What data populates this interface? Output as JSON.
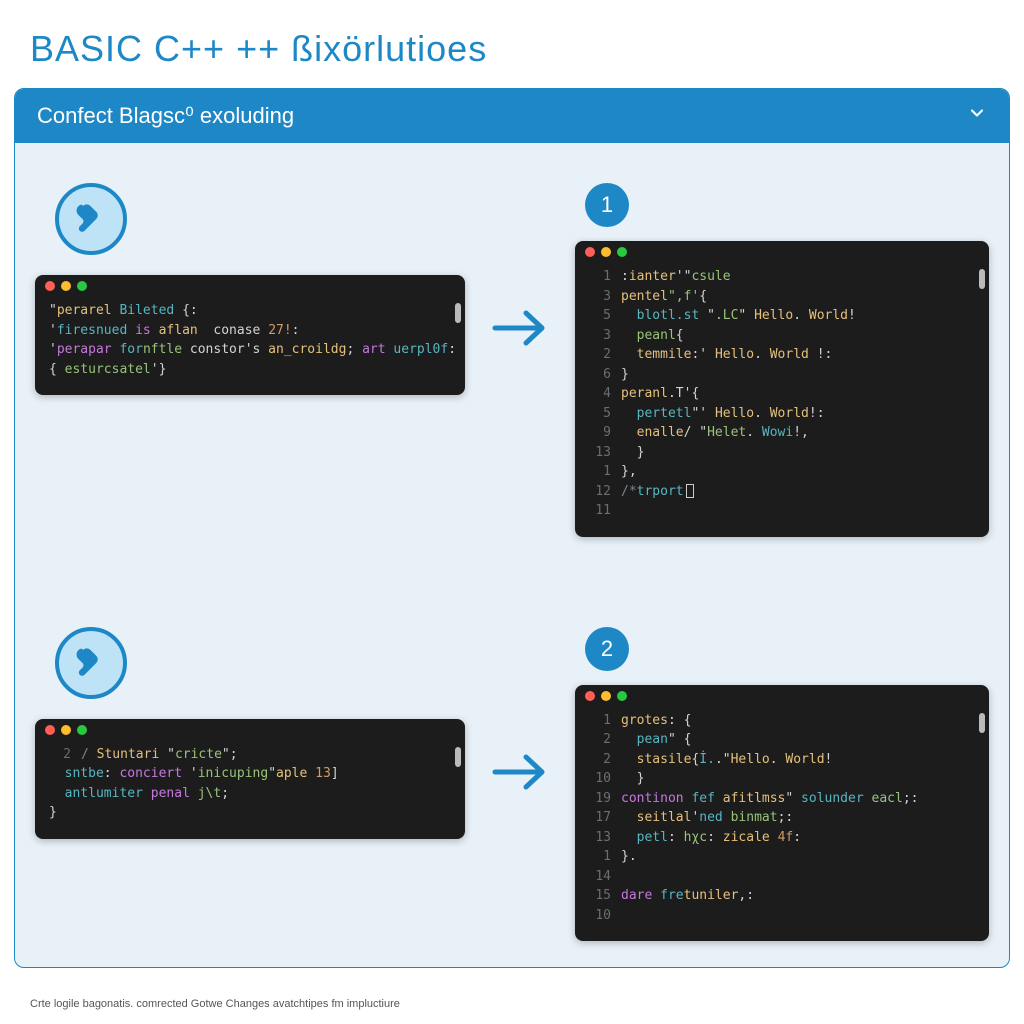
{
  "title": "BASIC C++ ++ ßixörlutioes",
  "panel_header": "Confect Blagsc⁰ exoluding",
  "footer": "Crte logile bagonatis. comrected Gotwe Changes avatchtipes fm impluctiure",
  "steps": [
    {
      "badge": "1",
      "left_code": [
        {
          "ln": "",
          "tokens": [
            [
              "plain",
              "\""
            ],
            [
              "func",
              "perarel"
            ],
            [
              "plain",
              " "
            ],
            [
              "id",
              "Bileted"
            ],
            [
              "plain",
              " {:"
            ]
          ]
        },
        {
          "ln": "",
          "tokens": [
            [
              "plain",
              "'"
            ],
            [
              "id",
              "firesnued"
            ],
            [
              "plain",
              " "
            ],
            [
              "key",
              "is"
            ],
            [
              "plain",
              " "
            ],
            [
              "func",
              "aflan"
            ],
            [
              "plain",
              "  conase "
            ],
            [
              "num",
              "27!"
            ],
            [
              "plain",
              ":"
            ]
          ]
        },
        {
          "ln": "",
          "tokens": [
            [
              "plain",
              "'"
            ],
            [
              "key",
              "perapar"
            ],
            [
              "plain",
              " "
            ],
            [
              "id",
              "for"
            ],
            [
              "str",
              "nftle"
            ],
            [
              "plain",
              " constor's "
            ],
            [
              "func",
              "an_croildg"
            ],
            [
              "plain",
              "; "
            ],
            [
              "key",
              "art"
            ],
            [
              "plain",
              " "
            ],
            [
              "id",
              "uerpl0f"
            ],
            [
              "plain",
              ":"
            ]
          ]
        },
        {
          "ln": "",
          "tokens": [
            [
              "plain",
              "{ "
            ],
            [
              "str",
              "esturcsatel"
            ],
            [
              "plain",
              "'}"
            ]
          ]
        }
      ],
      "right_code": [
        {
          "ln": "1",
          "tokens": [
            [
              "plain",
              ":"
            ],
            [
              "func",
              "ianter"
            ],
            [
              "plain",
              "'\""
            ],
            [
              "str",
              "csule"
            ]
          ]
        },
        {
          "ln": "3",
          "tokens": [
            [
              "func",
              "pentel"
            ],
            [
              "str",
              "\",f'"
            ],
            [
              "plain",
              "{"
            ]
          ]
        },
        {
          "ln": "5",
          "tokens": [
            [
              "plain",
              "  "
            ],
            [
              "id",
              "blotl.st"
            ],
            [
              "plain",
              " \""
            ],
            [
              "str",
              ".LC"
            ],
            [
              "plain",
              "\" "
            ],
            [
              "func",
              "Hello"
            ],
            [
              "plain",
              ". "
            ],
            [
              "func",
              "World"
            ],
            [
              "plain",
              "!"
            ]
          ]
        },
        {
          "ln": "3",
          "tokens": [
            [
              "plain",
              "  "
            ],
            [
              "str",
              "peanl"
            ],
            [
              "plain",
              "{"
            ]
          ]
        },
        {
          "ln": "2",
          "tokens": [
            [
              "plain",
              "  "
            ],
            [
              "func",
              "temmile"
            ],
            [
              "plain",
              ":' "
            ],
            [
              "func",
              "Hello"
            ],
            [
              "plain",
              ". "
            ],
            [
              "func",
              "World"
            ],
            [
              "plain",
              " !:"
            ]
          ]
        },
        {
          "ln": "6",
          "tokens": [
            [
              "plain",
              "}"
            ]
          ]
        },
        {
          "ln": "4",
          "tokens": [
            [
              "func",
              "peranl"
            ],
            [
              "plain",
              ".T'{"
            ]
          ]
        },
        {
          "ln": "5",
          "tokens": [
            [
              "plain",
              "  "
            ],
            [
              "id",
              "pertetl"
            ],
            [
              "plain",
              "\"' "
            ],
            [
              "func",
              "Hello"
            ],
            [
              "plain",
              ". "
            ],
            [
              "func",
              "World"
            ],
            [
              "plain",
              "!:"
            ]
          ]
        },
        {
          "ln": "9",
          "tokens": [
            [
              "plain",
              "  "
            ],
            [
              "func",
              "enalle"
            ],
            [
              "plain",
              "/ \""
            ],
            [
              "str",
              "Helet"
            ],
            [
              "plain",
              ". "
            ],
            [
              "id",
              "Wowi"
            ],
            [
              "plain",
              "!,"
            ]
          ]
        },
        {
          "ln": "13",
          "tokens": [
            [
              "plain",
              "  }"
            ]
          ]
        },
        {
          "ln": "1",
          "tokens": [
            [
              "plain",
              "},"
            ]
          ]
        },
        {
          "ln": "12",
          "tokens": [
            [
              "comment",
              "/*"
            ],
            [
              "id",
              "trport"
            ]
          ]
        },
        {
          "ln": "11",
          "tokens": []
        }
      ]
    },
    {
      "badge": "2",
      "left_code": [
        {
          "ln": "2",
          "tokens": [
            [
              "comment",
              "/ "
            ],
            [
              "func",
              "Stuntari"
            ],
            [
              "plain",
              " \""
            ],
            [
              "str",
              "cricte"
            ],
            [
              "plain",
              "\";"
            ]
          ]
        },
        {
          "ln": "",
          "tokens": [
            [
              "plain",
              "  "
            ],
            [
              "id",
              "sntbe"
            ],
            [
              "plain",
              ": "
            ],
            [
              "key",
              "conciert"
            ],
            [
              "plain",
              " '"
            ],
            [
              "str",
              "inicuping"
            ],
            [
              "plain",
              "\""
            ],
            [
              "func",
              "aple"
            ],
            [
              "plain",
              " "
            ],
            [
              "num",
              "13"
            ],
            [
              "plain",
              "]"
            ]
          ]
        },
        {
          "ln": "",
          "tokens": [
            [
              "plain",
              "  "
            ],
            [
              "id",
              "antlumiter"
            ],
            [
              "plain",
              " "
            ],
            [
              "key",
              "penal"
            ],
            [
              "plain",
              " "
            ],
            [
              "str",
              "j\\t"
            ],
            [
              "plain",
              ";"
            ]
          ]
        },
        {
          "ln": "",
          "tokens": [
            [
              "plain",
              "}"
            ]
          ]
        }
      ],
      "right_code": [
        {
          "ln": "1",
          "tokens": [
            [
              "func",
              "grotes"
            ],
            [
              "plain",
              ": {"
            ]
          ]
        },
        {
          "ln": "2",
          "tokens": [
            [
              "plain",
              "  "
            ],
            [
              "id",
              "pean"
            ],
            [
              "plain",
              "\" {"
            ]
          ]
        },
        {
          "ln": "2",
          "tokens": [
            [
              "plain",
              "  "
            ],
            [
              "func",
              "stasile"
            ],
            [
              "plain",
              "{"
            ],
            [
              "id",
              "İ."
            ],
            [
              "plain",
              ".\""
            ],
            [
              "func",
              "Hello"
            ],
            [
              "plain",
              ". "
            ],
            [
              "func",
              "World"
            ],
            [
              "plain",
              "!"
            ]
          ]
        },
        {
          "ln": "10",
          "tokens": [
            [
              "plain",
              "  }"
            ]
          ]
        },
        {
          "ln": "19",
          "tokens": [
            [
              "key",
              "continon"
            ],
            [
              "plain",
              " "
            ],
            [
              "id",
              "fef"
            ],
            [
              "plain",
              " "
            ],
            [
              "func",
              "afitlmss"
            ],
            [
              "plain",
              "\" "
            ],
            [
              "id",
              "solunder"
            ],
            [
              "plain",
              " "
            ],
            [
              "str",
              "eacl"
            ],
            [
              "plain",
              ";:"
            ]
          ]
        },
        {
          "ln": "17",
          "tokens": [
            [
              "plain",
              "  "
            ],
            [
              "func",
              "seitlal"
            ],
            [
              "plain",
              "'"
            ],
            [
              "id",
              "ned"
            ],
            [
              "plain",
              " "
            ],
            [
              "str",
              "binmat"
            ],
            [
              "plain",
              ";:"
            ]
          ]
        },
        {
          "ln": "13",
          "tokens": [
            [
              "plain",
              "  "
            ],
            [
              "id",
              "petl"
            ],
            [
              "plain",
              ": "
            ],
            [
              "str",
              "hχc"
            ],
            [
              "plain",
              ": "
            ],
            [
              "func",
              "zicale"
            ],
            [
              "plain",
              " "
            ],
            [
              "num",
              "4f"
            ],
            [
              "plain",
              ":"
            ]
          ]
        },
        {
          "ln": "1",
          "tokens": [
            [
              "plain",
              "}."
            ]
          ]
        },
        {
          "ln": "14",
          "tokens": []
        },
        {
          "ln": "15",
          "tokens": [
            [
              "key",
              "dare"
            ],
            [
              "plain",
              " "
            ],
            [
              "id",
              "fre"
            ],
            [
              "func",
              "tuniler"
            ],
            [
              "plain",
              ",:"
            ]
          ]
        },
        {
          "ln": "10",
          "tokens": []
        }
      ]
    }
  ]
}
